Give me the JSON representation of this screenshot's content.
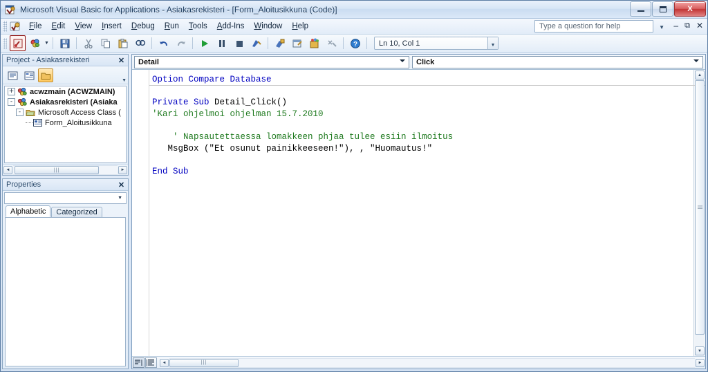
{
  "window": {
    "title": "Microsoft Visual Basic for Applications - Asiakasrekisteri - [Form_Aloitusikkuna (Code)]",
    "app_icon": "vba-app-icon",
    "minimize_label": "Minimize",
    "maximize_label": "Maximize",
    "close_label": "X"
  },
  "menubar": {
    "app_icon": "vba-menu-icon",
    "items": [
      {
        "label": "File",
        "accel": "F"
      },
      {
        "label": "Edit",
        "accel": "E"
      },
      {
        "label": "View",
        "accel": "V"
      },
      {
        "label": "Insert",
        "accel": "I"
      },
      {
        "label": "Debug",
        "accel": "D"
      },
      {
        "label": "Run",
        "accel": "R"
      },
      {
        "label": "Tools",
        "accel": "T"
      },
      {
        "label": "Add-Ins",
        "accel": "A"
      },
      {
        "label": "Window",
        "accel": "W"
      },
      {
        "label": "Help",
        "accel": "H"
      }
    ],
    "help_box_placeholder": "Type a question for help",
    "mdi_restore": "Restore Window",
    "mdi_minimize": "Minimize Window",
    "mdi_close": "Close Window"
  },
  "toolbar": {
    "buttons": [
      {
        "name": "view-access-icon",
        "title": "View Microsoft Access",
        "selected": true
      },
      {
        "name": "insert-module-icon",
        "title": "Insert",
        "selected": false
      },
      {
        "name": "save-icon",
        "title": "Save Asiakasrekisteri",
        "selected": false
      },
      {
        "name": "cut-icon",
        "title": "Cut",
        "selected": false
      },
      {
        "name": "copy-icon",
        "title": "Copy",
        "selected": false
      },
      {
        "name": "paste-icon",
        "title": "Paste",
        "selected": false
      },
      {
        "name": "find-icon",
        "title": "Find",
        "selected": false
      },
      {
        "name": "undo-icon",
        "title": "Undo",
        "selected": false
      },
      {
        "name": "redo-icon",
        "title": "Redo",
        "selected": false
      },
      {
        "name": "run-icon",
        "title": "Run Sub/UserForm",
        "selected": false
      },
      {
        "name": "break-icon",
        "title": "Break",
        "selected": false
      },
      {
        "name": "reset-icon",
        "title": "Reset",
        "selected": false
      },
      {
        "name": "design-mode-icon",
        "title": "Design Mode",
        "selected": false
      },
      {
        "name": "project-explorer-icon",
        "title": "Project Explorer",
        "selected": false
      },
      {
        "name": "properties-window-icon",
        "title": "Properties Window",
        "selected": false
      },
      {
        "name": "object-browser-icon",
        "title": "Object Browser",
        "selected": false
      },
      {
        "name": "toolbox-icon",
        "title": "Toolbox",
        "selected": false
      },
      {
        "name": "help-icon",
        "title": "Microsoft Visual Basic for Applications Help",
        "selected": false
      }
    ],
    "context_value": "Ln 10, Col 1"
  },
  "project_panel": {
    "title": "Project - Asiakasrekisteri",
    "close_label": "✕",
    "tools": [
      {
        "name": "view-code-icon",
        "active": false
      },
      {
        "name": "view-object-icon",
        "active": false
      },
      {
        "name": "toggle-folders-icon",
        "active": true
      }
    ],
    "tree": [
      {
        "label": "acwzmain (ACWZMAIN)",
        "depth": 0,
        "expander": "+",
        "icon": "project-icon",
        "bold": true
      },
      {
        "label": "Asiakasrekisteri (Asiaka",
        "depth": 0,
        "expander": "-",
        "icon": "project-icon",
        "bold": true
      },
      {
        "label": "Microsoft Access Class (",
        "depth": 1,
        "expander": "-",
        "icon": "folder-icon",
        "bold": false
      },
      {
        "label": "Form_Aloitusikkuna",
        "depth": 2,
        "expander": "",
        "icon": "form-module-icon",
        "bold": false
      }
    ],
    "scroll_left": "◄",
    "scroll_right": "►",
    "thumb_grip": "|||"
  },
  "properties_panel": {
    "title": "Properties",
    "close_label": "✕",
    "selected_object": "",
    "dropdown_caret": "▼",
    "tabs": [
      {
        "label": "Alphabetic",
        "active": true
      },
      {
        "label": "Categorized",
        "active": false
      }
    ],
    "rows": []
  },
  "code_window": {
    "object_combo": {
      "value": "Detail",
      "caret": "▼"
    },
    "procedure_combo": {
      "value": "Click",
      "caret": "▼"
    },
    "lines": [
      [
        {
          "t": "Option Compare Database",
          "c": "kw"
        }
      ],
      [],
      [
        {
          "t": "Private Sub ",
          "c": "kw"
        },
        {
          "t": "Detail_Click()",
          "c": "txt"
        }
      ],
      [
        {
          "t": "'Kari ohjelmoi ohjelman 15.7.2010",
          "c": "cmt"
        }
      ],
      [],
      [
        {
          "t": "    ' Napsautettaessa lomakkeen phjaa tulee esiin ilmoitus",
          "c": "cmt"
        }
      ],
      [
        {
          "t": "   MsgBox (\"Et osunut painikkeeseen!\"), , \"Huomautus!\"",
          "c": "txt"
        }
      ],
      [],
      [
        {
          "t": "End Sub",
          "c": "kw"
        }
      ]
    ],
    "view_buttons": [
      {
        "name": "procedure-view-button",
        "active": true
      },
      {
        "name": "full-module-view-button",
        "active": false
      }
    ],
    "scroll": {
      "up": "▲",
      "down": "▼",
      "left": "◄",
      "right": "►",
      "grip": "|||"
    }
  },
  "colors": {
    "keyword": "#0000c0",
    "comment": "#1f7a1f",
    "text": "#000000",
    "accent": "#c23434",
    "chrome": "#d7e5f6"
  }
}
